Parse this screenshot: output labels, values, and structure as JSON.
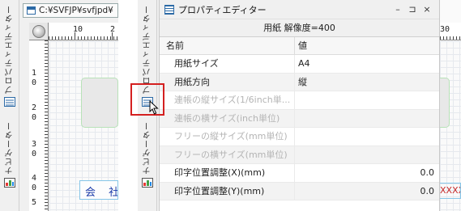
{
  "left_panel": {
    "vertical_tabs": [
      {
        "label": "プロパティエディター",
        "icon": "property-editor-icon"
      },
      {
        "label": "ナビゲーター",
        "icon": "navigator-icon"
      }
    ],
    "document_title": "C:¥SVFJP¥svfjpd¥",
    "ruler_top_labels": [
      "10",
      "2"
    ],
    "ruler_left_labels": [
      "1",
      "0",
      "2",
      "0",
      "3",
      "0",
      "4",
      "0",
      "5"
    ],
    "text_field": "会 社"
  },
  "property_editor": {
    "window_title": "プロパティエディター",
    "controls": {
      "minimize": "–",
      "pin": "⊐",
      "close": "×"
    },
    "caption": "用紙 解像度=400",
    "headers": {
      "name": "名前",
      "value": "値"
    },
    "rows": [
      {
        "name": "用紙サイズ",
        "value": "A4",
        "enabled": true
      },
      {
        "name": "用紙方向",
        "value": "縦",
        "enabled": true
      },
      {
        "name": "連帳の縦サイズ(1/6inch単...",
        "value": "",
        "enabled": false
      },
      {
        "name": "連帳の横サイズ(inch単位)",
        "value": "",
        "enabled": false
      },
      {
        "name": "フリーの縦サイズ(mm単位)",
        "value": "",
        "enabled": false
      },
      {
        "name": "フリーの横サイズ(mm単位)",
        "value": "",
        "enabled": false
      },
      {
        "name": "印字位置調整(X)(mm)",
        "value": "0.0",
        "enabled": true
      },
      {
        "name": "印字位置調整(Y)(mm)",
        "value": "0.0",
        "enabled": true
      }
    ],
    "side_tabs": [
      {
        "label": "プロパティエディター"
      },
      {
        "label": "ナビゲーター"
      }
    ],
    "edge_ruler_label": "30",
    "edge_red_text": "XXXX"
  },
  "colors": {
    "highlight": "#d42020",
    "field_border": "#86c6e8",
    "field_text": "#1a3aa8",
    "shape_border": "#b8e2b8"
  }
}
